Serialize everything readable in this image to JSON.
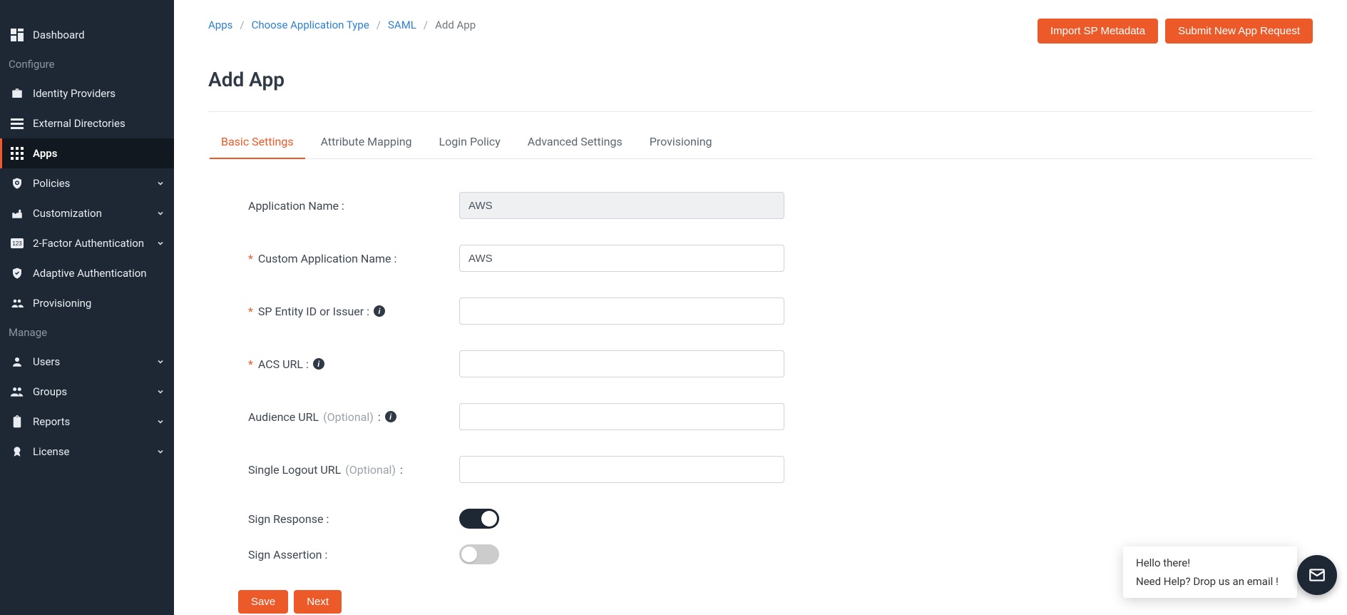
{
  "sidebar": {
    "items": [
      {
        "label": "Dashboard"
      }
    ],
    "section_configure": "Configure",
    "configure_items": [
      {
        "label": "Identity Providers",
        "chevron": false
      },
      {
        "label": "External Directories",
        "chevron": false
      },
      {
        "label": "Apps",
        "chevron": false,
        "active": true
      },
      {
        "label": "Policies",
        "chevron": true
      },
      {
        "label": "Customization",
        "chevron": true
      },
      {
        "label": "2-Factor Authentication",
        "chevron": true
      },
      {
        "label": "Adaptive Authentication",
        "chevron": false
      },
      {
        "label": "Provisioning",
        "chevron": false
      }
    ],
    "section_manage": "Manage",
    "manage_items": [
      {
        "label": "Users",
        "chevron": true
      },
      {
        "label": "Groups",
        "chevron": true
      },
      {
        "label": "Reports",
        "chevron": true
      },
      {
        "label": "License",
        "chevron": true
      }
    ]
  },
  "breadcrumb": {
    "items": [
      "Apps",
      "Choose Application Type",
      "SAML",
      "Add App"
    ]
  },
  "header": {
    "import_btn": "Import SP Metadata",
    "submit_btn": "Submit New App Request",
    "title": "Add App"
  },
  "tabs": [
    {
      "label": "Basic Settings",
      "active": true
    },
    {
      "label": "Attribute Mapping"
    },
    {
      "label": "Login Policy"
    },
    {
      "label": "Advanced Settings"
    },
    {
      "label": "Provisioning"
    }
  ],
  "form": {
    "app_name_label": "Application Name :",
    "app_name_value": "AWS",
    "custom_name_label": "Custom Application Name :",
    "custom_name_value": "AWS",
    "sp_entity_label": "SP Entity ID or Issuer :",
    "sp_entity_value": "",
    "acs_label": "ACS URL :",
    "acs_value": "",
    "audience_label_main": "Audience URL",
    "audience_label_opt": "(Optional)",
    "audience_label_colon": " :",
    "audience_value": "",
    "slo_label_main": "Single Logout URL",
    "slo_label_opt": "(Optional)",
    "slo_label_colon": " :",
    "slo_value": "",
    "sign_response_label": "Sign Response :",
    "sign_response_on": true,
    "sign_assertion_label": "Sign Assertion :",
    "sign_assertion_on": false,
    "save_btn": "Save",
    "next_btn": "Next"
  },
  "chat": {
    "line1": "Hello there!",
    "line2": "Need Help? Drop us an email !"
  }
}
